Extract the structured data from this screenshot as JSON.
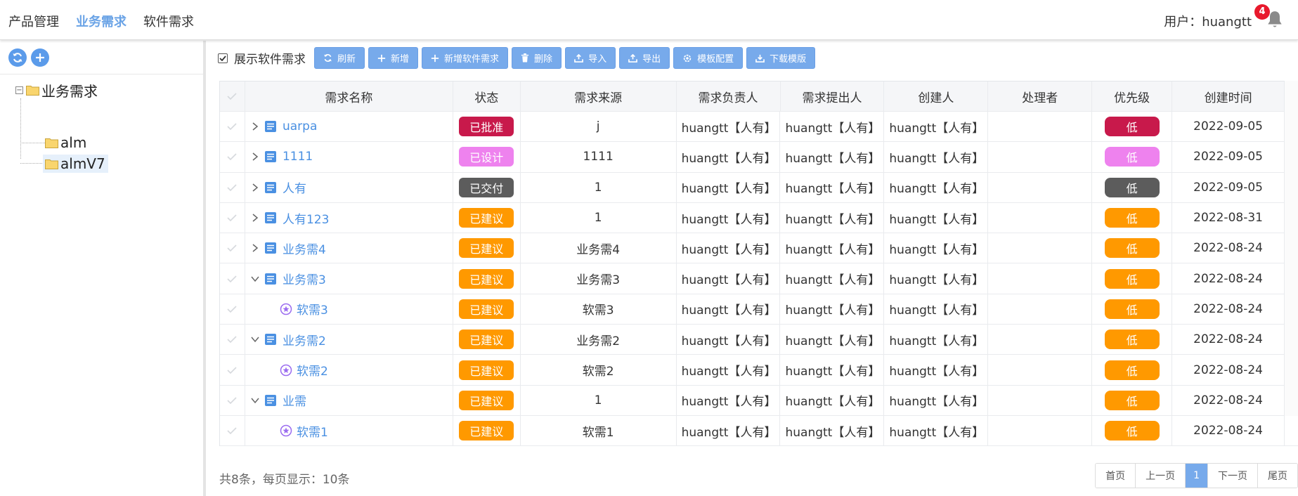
{
  "topnav": {
    "items": [
      {
        "label": "产品管理",
        "active": false
      },
      {
        "label": "业务需求",
        "active": true
      },
      {
        "label": "软件需求",
        "active": false
      }
    ],
    "user_label": "用户：huangtt",
    "notification_count": "4"
  },
  "sidebar": {
    "tree": {
      "root": "业务需求",
      "children": [
        "alm",
        "almV7"
      ],
      "selected": "almV7"
    }
  },
  "toolbar": {
    "show_software_label": "展示软件需求",
    "show_software_checked": true,
    "buttons": {
      "refresh": "刷新",
      "add": "新增",
      "add_software": "新增软件需求",
      "delete": "删除",
      "import": "导入",
      "export": "导出",
      "template_config": "模板配置",
      "download_template": "下载模版"
    }
  },
  "table": {
    "headers": [
      "需求名称",
      "状态",
      "需求来源",
      "需求负责人",
      "需求提出人",
      "创建人",
      "处理者",
      "优先级",
      "创建时间"
    ],
    "rows": [
      {
        "name": "uarpa",
        "kind": "business",
        "expand": "collapsed",
        "status": "已批准",
        "status_color": "#c8194b",
        "source": "j",
        "owner": "huangtt【人有】",
        "proposer": "huangtt【人有】",
        "creator": "huangtt【人有】",
        "handler": "",
        "priority": "低",
        "priority_color": "#c8194b",
        "created": "2022-09-05"
      },
      {
        "name": "1111",
        "kind": "business",
        "expand": "collapsed",
        "status": "已设计",
        "status_color": "#ee82ee",
        "source": "1111",
        "owner": "huangtt【人有】",
        "proposer": "huangtt【人有】",
        "creator": "huangtt【人有】",
        "handler": "",
        "priority": "低",
        "priority_color": "#ee82ee",
        "created": "2022-09-05"
      },
      {
        "name": "人有",
        "kind": "business",
        "expand": "collapsed",
        "status": "已交付",
        "status_color": "#5c5c5c",
        "source": "1",
        "owner": "huangtt【人有】",
        "proposer": "huangtt【人有】",
        "creator": "huangtt【人有】",
        "handler": "",
        "priority": "低",
        "priority_color": "#5c5c5c",
        "created": "2022-09-05"
      },
      {
        "name": "人有123",
        "kind": "business",
        "expand": "collapsed",
        "status": "已建议",
        "status_color": "#ff9900",
        "source": "1",
        "owner": "huangtt【人有】",
        "proposer": "huangtt【人有】",
        "creator": "huangtt【人有】",
        "handler": "",
        "priority": "低",
        "priority_color": "#ff9900",
        "created": "2022-08-31"
      },
      {
        "name": "业务需4",
        "kind": "business",
        "expand": "collapsed",
        "status": "已建议",
        "status_color": "#ff9900",
        "source": "业务需4",
        "owner": "huangtt【人有】",
        "proposer": "huangtt【人有】",
        "creator": "huangtt【人有】",
        "handler": "",
        "priority": "低",
        "priority_color": "#ff9900",
        "created": "2022-08-24"
      },
      {
        "name": "业务需3",
        "kind": "business",
        "expand": "expanded",
        "status": "已建议",
        "status_color": "#ff9900",
        "source": "业务需3",
        "owner": "huangtt【人有】",
        "proposer": "huangtt【人有】",
        "creator": "huangtt【人有】",
        "handler": "",
        "priority": "低",
        "priority_color": "#ff9900",
        "created": "2022-08-24"
      },
      {
        "name": "软需3",
        "kind": "software",
        "expand": "none",
        "status": "已建议",
        "status_color": "#ff9900",
        "source": "软需3",
        "owner": "huangtt【人有】",
        "proposer": "huangtt【人有】",
        "creator": "huangtt【人有】",
        "handler": "",
        "priority": "低",
        "priority_color": "#ff9900",
        "created": "2022-08-24"
      },
      {
        "name": "业务需2",
        "kind": "business",
        "expand": "expanded",
        "status": "已建议",
        "status_color": "#ff9900",
        "source": "业务需2",
        "owner": "huangtt【人有】",
        "proposer": "huangtt【人有】",
        "creator": "huangtt【人有】",
        "handler": "",
        "priority": "低",
        "priority_color": "#ff9900",
        "created": "2022-08-24"
      },
      {
        "name": "软需2",
        "kind": "software",
        "expand": "none",
        "status": "已建议",
        "status_color": "#ff9900",
        "source": "软需2",
        "owner": "huangtt【人有】",
        "proposer": "huangtt【人有】",
        "creator": "huangtt【人有】",
        "handler": "",
        "priority": "低",
        "priority_color": "#ff9900",
        "created": "2022-08-24"
      },
      {
        "name": "业需",
        "kind": "business",
        "expand": "expanded",
        "status": "已建议",
        "status_color": "#ff9900",
        "source": "1",
        "owner": "huangtt【人有】",
        "proposer": "huangtt【人有】",
        "creator": "huangtt【人有】",
        "handler": "",
        "priority": "低",
        "priority_color": "#ff9900",
        "created": "2022-08-24"
      },
      {
        "name": "软需1",
        "kind": "software",
        "expand": "none",
        "status": "已建议",
        "status_color": "#ff9900",
        "source": "软需1",
        "owner": "huangtt【人有】",
        "proposer": "huangtt【人有】",
        "creator": "huangtt【人有】",
        "handler": "",
        "priority": "低",
        "priority_color": "#ff9900",
        "created": "2022-08-24"
      }
    ]
  },
  "footer": {
    "total_text": "共8条，每页显示：10条",
    "pager": {
      "first": "首页",
      "prev": "上一页",
      "current": "1",
      "next": "下一页",
      "last": "尾页"
    }
  },
  "colors": {
    "accent": "#77aaeb",
    "link": "#4a90e2",
    "active_nav": "#6aa3e6",
    "badge_red": "#e8192c"
  }
}
